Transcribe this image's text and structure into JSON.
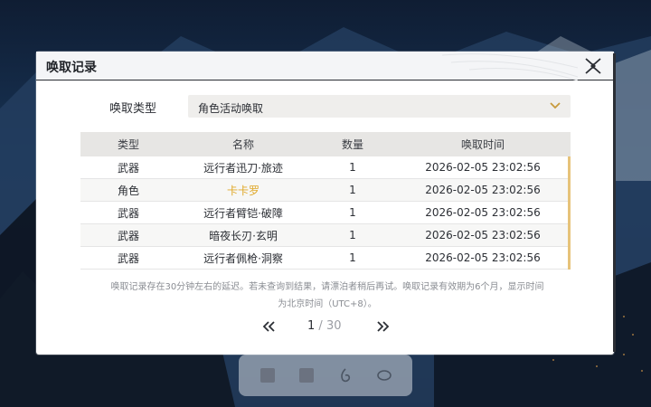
{
  "dialog": {
    "title": "唤取记录"
  },
  "filter": {
    "label": "唤取类型",
    "selected": "角色活动唤取"
  },
  "table": {
    "headers": [
      "类型",
      "名称",
      "数量",
      "唤取时间"
    ],
    "rows": [
      {
        "type": "武器",
        "name": "远行者迅刀·旅迹",
        "qty": "1",
        "time": "2026-02-05 23:02:56",
        "highlight": false
      },
      {
        "type": "角色",
        "name": "卡卡罗",
        "qty": "1",
        "time": "2026-02-05 23:02:56",
        "highlight": true
      },
      {
        "type": "武器",
        "name": "远行者臂铠·破障",
        "qty": "1",
        "time": "2026-02-05 23:02:56",
        "highlight": false
      },
      {
        "type": "武器",
        "name": "暗夜长刃·玄明",
        "qty": "1",
        "time": "2026-02-05 23:02:56",
        "highlight": false
      },
      {
        "type": "武器",
        "name": "远行者佩枪·洞察",
        "qty": "1",
        "time": "2026-02-05 23:02:56",
        "highlight": false
      }
    ],
    "highlight_color": "#e0a828"
  },
  "note": {
    "line1": "唤取记录存在30分钟左右的延迟。若未查询到结果，请漂泊者稍后再试。唤取记录有效期为6个月，显示时间",
    "line2": "为北京时间（UTC+8）。"
  },
  "pager": {
    "current": "1",
    "separator": " / ",
    "total": "30"
  },
  "icons": {
    "close": "close-x-icon",
    "dropdown": "chevron-down-icon",
    "prev": "double-chevron-left-icon",
    "next": "double-chevron-right-icon"
  }
}
